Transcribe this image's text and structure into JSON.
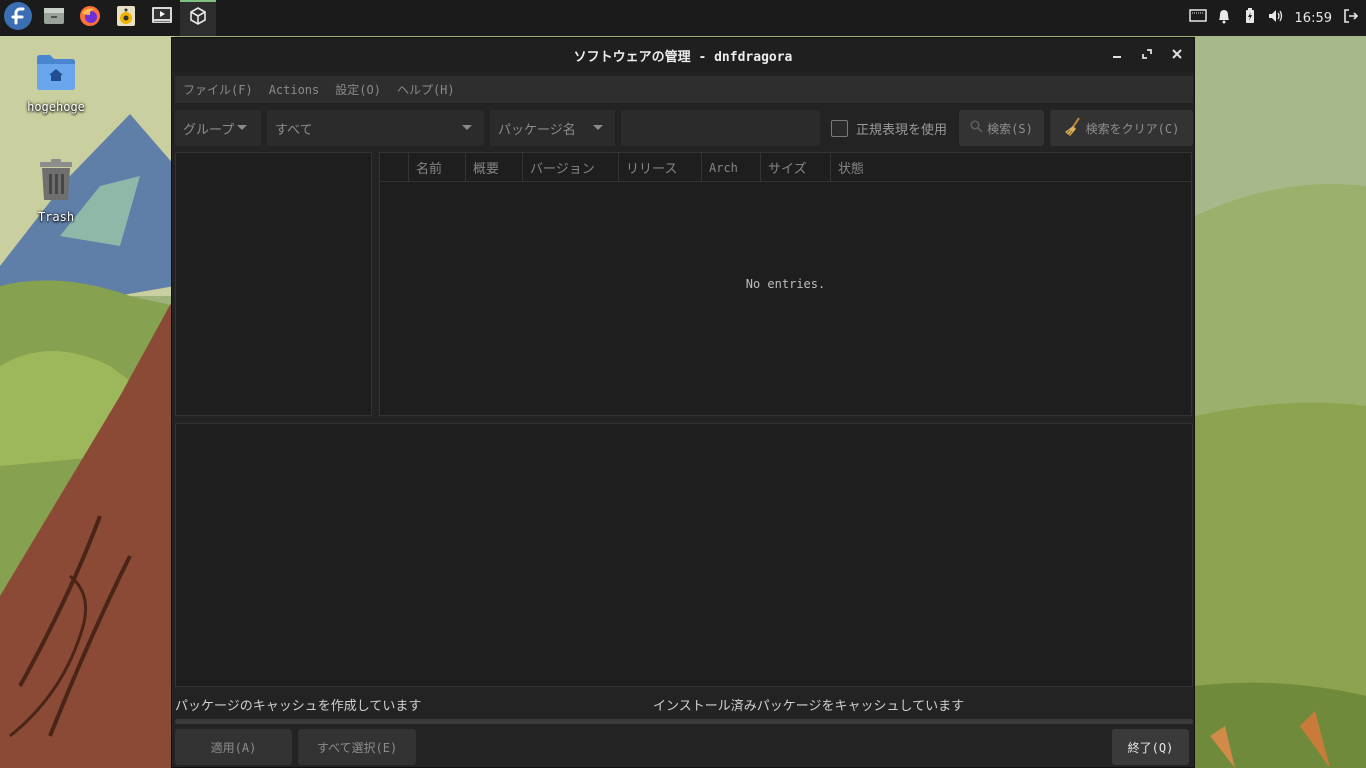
{
  "panel": {
    "launchers": [
      "fedora-logo-icon",
      "file-manager-icon",
      "firefox-icon",
      "rhythmbox-icon",
      "video-player-icon",
      "package-manager-icon"
    ],
    "clock": "16:59"
  },
  "desktop": {
    "icons": [
      {
        "label": "hogehoge"
      },
      {
        "label": "Trash"
      }
    ]
  },
  "window": {
    "title": "ソフトウェアの管理 - dnfdragora",
    "menu": {
      "file": "ファイル(F)",
      "actions": "Actions",
      "settings": "設定(O)",
      "help": "ヘルプ(H)"
    },
    "filters": {
      "group_combo": "グループ",
      "status_combo": "すべて",
      "search_field_combo": "パッケージ名",
      "search_value": "",
      "regex_label": "正規表現を使用",
      "regex_checked": false,
      "search_button": "検索(S)",
      "clear_button": "検索をクリア(C)"
    },
    "package_table": {
      "columns": [
        "",
        "名前",
        "概要",
        "バージョン",
        "リリース",
        "Arch",
        "サイズ",
        "状態"
      ],
      "rows": [],
      "empty_message": "No entries."
    },
    "status": {
      "left": "パッケージのキャッシュを作成しています",
      "right": "インストール済みパッケージをキャッシュしています",
      "progress": 0
    },
    "buttons": {
      "apply": "適用(A)",
      "select_all": "すべて選択(E)",
      "quit": "終了(Q)"
    }
  }
}
